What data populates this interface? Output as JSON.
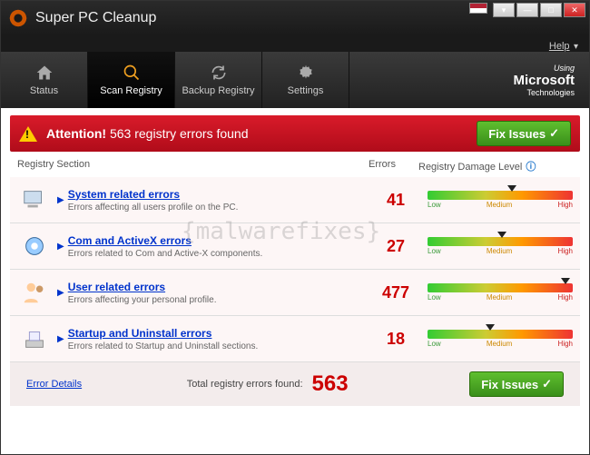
{
  "app": {
    "title": "Super PC Cleanup",
    "help": "Help"
  },
  "window": {
    "minimize": "—",
    "maximize": "□",
    "close": "✕",
    "lang_dropdown": "▾"
  },
  "nav": {
    "items": [
      {
        "label": "Status"
      },
      {
        "label": "Scan Registry"
      },
      {
        "label": "Backup Registry"
      },
      {
        "label": "Settings"
      }
    ],
    "ms": {
      "using": "Using",
      "name": "Microsoft",
      "tech": "Technologies"
    }
  },
  "alert": {
    "attention": "Attention!",
    "message": " 563 registry errors found",
    "fix": "Fix Issues",
    "check": "✓"
  },
  "headers": {
    "section": "Registry Section",
    "errors": "Errors",
    "damage": "Registry Damage Level",
    "info": "ⓘ"
  },
  "gauge": {
    "low": "Low",
    "medium": "Medium",
    "high": "High"
  },
  "rows": [
    {
      "title": "System related errors",
      "desc": "Errors affecting all users profile on the PC.",
      "errors": "41",
      "pos": "55"
    },
    {
      "title": "Com and ActiveX errors",
      "desc": "Errors related to Com and Active-X components.",
      "errors": "27",
      "pos": "48"
    },
    {
      "title": "User related errors",
      "desc": "Errors affecting your personal profile.",
      "errors": "477",
      "pos": "92"
    },
    {
      "title": "Startup and Uninstall errors",
      "desc": "Errors related to Startup and Uninstall sections.",
      "errors": "18",
      "pos": "40"
    }
  ],
  "footer": {
    "details": "Error Details",
    "total_label": "Total registry errors found:",
    "total": "563",
    "fix": "Fix Issues",
    "check": "✓"
  },
  "watermark": "{malwarefixes}"
}
